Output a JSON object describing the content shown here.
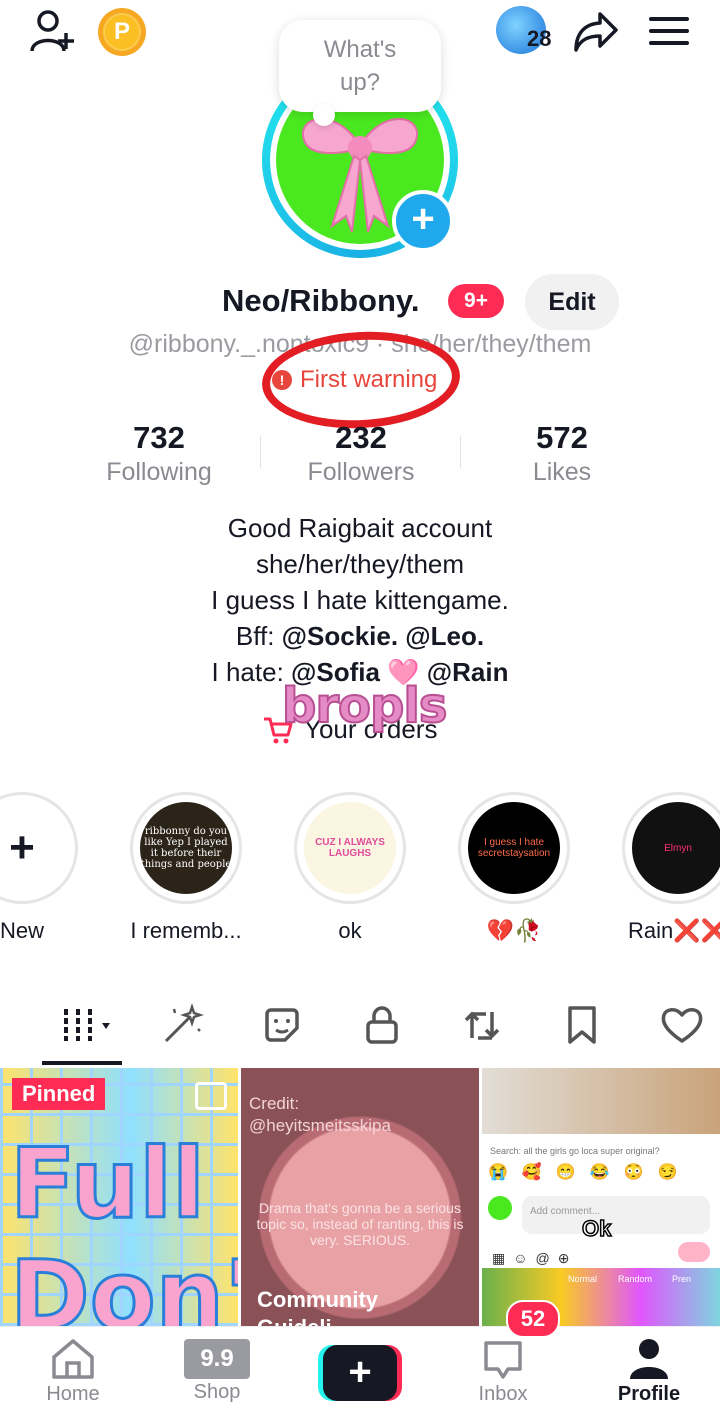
{
  "top_bar": {
    "coin_label": "P",
    "globe_count": "28"
  },
  "avatar_bubble": "What's\nup?",
  "profile": {
    "name": "Neo/Ribbony.",
    "name_badge": "9+",
    "edit_label": "Edit",
    "handle": "@ribbony._.nontoxic9 · she/her/they/them",
    "warning": "First warning"
  },
  "stats": [
    {
      "value": "732",
      "label": "Following"
    },
    {
      "value": "232",
      "label": "Followers"
    },
    {
      "value": "572",
      "label": "Likes"
    }
  ],
  "bio": {
    "line1": "Good Raigbait account",
    "line2": "she/her/they/them",
    "line3": "I guess I hate kittengame.",
    "line4_prefix": "Bff: ",
    "line4_mentions": "@Sockie. @Leo.",
    "line5_prefix": "I hate: ",
    "line5_mention1": "@Sofia",
    "line5_emoji": "🩷",
    "line5_mention2": "@Rain"
  },
  "overlay_sticker": "bropls",
  "orders_label": "Your orders",
  "highlights": [
    {
      "label": "New",
      "thumb": "+"
    },
    {
      "label": "I rememb...",
      "thumb": "ribbonny do you like Yep I played it before their things and people"
    },
    {
      "label": "ok",
      "thumb": "CUZ I ALWAYS LAUGHS"
    },
    {
      "label": "💔🥀",
      "thumb": "I guess I hate secretstaysation"
    },
    {
      "label": "Rain❌❌",
      "thumb": "Elmyn"
    }
  ],
  "content_tabs": [
    "videos-icon",
    "spark-icon",
    "sticker-icon",
    "lock-icon",
    "repost-icon",
    "bookmark-icon",
    "heart-icon"
  ],
  "grid": {
    "pinned_label": "Pinned",
    "cell1_text": "Full Don't",
    "cell2_credit": "Credit:",
    "cell2_handle": "@heyitsmeitsskipa",
    "cell2_body": "Drama that's gonna be a serious topic so, instead of ranting, this is very. SERIOUS.",
    "cell2_title": "Community Guideli...",
    "cell3_search": "Search: all the girls go loca super original?",
    "cell3_comment_placeholder": "Add comment...",
    "cell3_ok": "Ok",
    "cell3_mode1": "Normal",
    "cell3_mode2": "Random",
    "cell3_mode3": "Pren"
  },
  "bottom_nav": {
    "home": "Home",
    "shop": "Shop",
    "shop_icon_text": "9.9",
    "inbox": "Inbox",
    "inbox_badge": "52",
    "profile": "Profile"
  },
  "colors": {
    "accent": "#fe2c55",
    "warning": "#e8453c",
    "avatar_ring": "#25f4ee",
    "avatar_bg": "#49e81f"
  }
}
